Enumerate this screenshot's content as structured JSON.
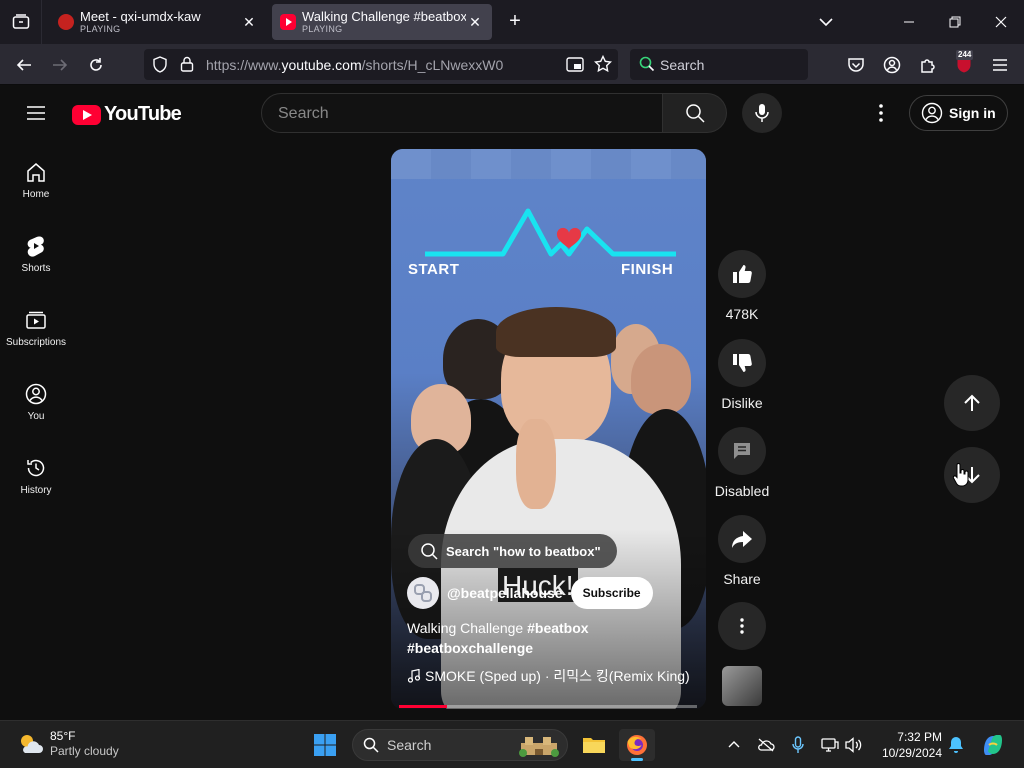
{
  "browser": {
    "tabs": [
      {
        "title": "Meet - qxi-umdx-kaw",
        "status": "PLAYING"
      },
      {
        "title": "Walking Challenge #beatbox #b",
        "status": "PLAYING"
      }
    ],
    "url_prefix": "https://www.",
    "url_domain": "youtube.com",
    "url_path": "/shorts/H_cLNwexxW0",
    "search_label": "Search",
    "extension_badge": "244"
  },
  "youtube": {
    "logo_text": "YouTube",
    "search_placeholder": "Search",
    "sign_in_label": "Sign in",
    "sidebar": [
      {
        "label": "Home",
        "icon": "home-icon"
      },
      {
        "label": "Shorts",
        "icon": "shorts-icon"
      },
      {
        "label": "Subscriptions",
        "icon": "subscriptions-icon"
      },
      {
        "label": "You",
        "icon": "you-icon"
      },
      {
        "label": "History",
        "icon": "history-icon"
      }
    ]
  },
  "short": {
    "overlay_start": "START",
    "overlay_finish": "FINISH",
    "caption_text": "Huck!",
    "search_suggestion": "Search \"how to beatbox\"",
    "channel_handle": "@beatpellahouse",
    "subscribe_label": "Subscribe",
    "title_plain": "Walking Challenge ",
    "title_tag1": "#beatbox",
    "title_tag2": "#beatboxchallenge",
    "sound": "SMOKE (Sped up) · 리믹스 킹(Remix King)",
    "progress_fraction": 0.16,
    "actions": {
      "like_count": "478K",
      "dislike_label": "Dislike",
      "comments_label": "Disabled",
      "share_label": "Share"
    }
  },
  "taskbar": {
    "temperature": "85°F",
    "weather_desc": "Partly cloudy",
    "search_label": "Search",
    "time": "7:32 PM",
    "date": "10/29/2024"
  },
  "colors": {
    "yt_red": "#ff0033",
    "neon_line": "#19e3f0",
    "browser_tab_active": "#42414d"
  }
}
